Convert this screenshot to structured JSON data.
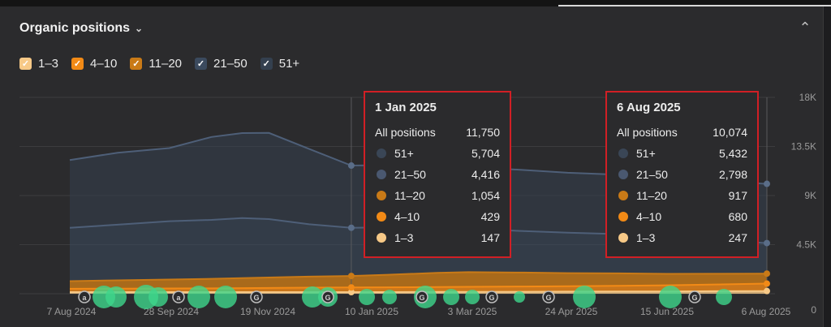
{
  "header": {
    "title": "Organic positions"
  },
  "legend": [
    {
      "label": "1–3",
      "color": "#f7c987",
      "checked": true
    },
    {
      "label": "4–10",
      "color": "#f28a16",
      "checked": true
    },
    {
      "label": "11–20",
      "color": "#c97a17",
      "checked": true
    },
    {
      "label": "21–50",
      "color": "#3b4a5e",
      "checked": true
    },
    {
      "label": "51+",
      "color": "#34404f",
      "checked": true
    }
  ],
  "tooltips": [
    {
      "date": "1 Jan 2025",
      "all_label": "All positions",
      "all_value": "11,750",
      "rows": [
        {
          "label": "51+",
          "value": "5,704",
          "color": "#3a4656"
        },
        {
          "label": "21–50",
          "value": "4,416",
          "color": "#4a5870"
        },
        {
          "label": "11–20",
          "value": "1,054",
          "color": "#c97a17"
        },
        {
          "label": "4–10",
          "value": "429",
          "color": "#f28a16"
        },
        {
          "label": "1–3",
          "value": "147",
          "color": "#f7c987"
        }
      ]
    },
    {
      "date": "6 Aug 2025",
      "all_label": "All positions",
      "all_value": "10,074",
      "rows": [
        {
          "label": "51+",
          "value": "5,432",
          "color": "#3a4656"
        },
        {
          "label": "21–50",
          "value": "2,798",
          "color": "#4a5870"
        },
        {
          "label": "11–20",
          "value": "917",
          "color": "#c97a17"
        },
        {
          "label": "4–10",
          "value": "680",
          "color": "#f28a16"
        },
        {
          "label": "1–3",
          "value": "247",
          "color": "#f7c987"
        }
      ]
    }
  ],
  "chart_data": {
    "type": "area",
    "stacked": true,
    "x_labels": [
      "7 Aug 2024",
      "28 Sep 2024",
      "19 Nov 2024",
      "10 Jan 2025",
      "3 Mar 2025",
      "24 Apr 2025",
      "15 Jun 2025",
      "6 Aug 2025"
    ],
    "y_ticks": [
      "0",
      "4.5K",
      "9K",
      "13.5K",
      "18K"
    ],
    "ylim": [
      0,
      18000
    ],
    "x_dates": [
      "2024-08-07",
      "2024-09-01",
      "2024-09-28",
      "2024-10-20",
      "2024-11-05",
      "2024-11-19",
      "2024-12-10",
      "2025-01-01",
      "2025-01-20",
      "2025-02-15",
      "2025-03-03",
      "2025-04-01",
      "2025-04-24",
      "2025-05-20",
      "2025-06-15",
      "2025-07-10",
      "2025-08-06"
    ],
    "series": [
      {
        "name": "1–3",
        "color": "#f7c987",
        "values": [
          150,
          150,
          150,
          150,
          150,
          150,
          150,
          147,
          150,
          160,
          170,
          180,
          190,
          200,
          210,
          230,
          247
        ]
      },
      {
        "name": "4–10",
        "color": "#f28a16",
        "values": [
          300,
          320,
          330,
          340,
          360,
          380,
          410,
          429,
          440,
          450,
          460,
          480,
          500,
          520,
          560,
          620,
          680
        ]
      },
      {
        "name": "11–20",
        "color": "#c97a17",
        "values": [
          700,
          760,
          820,
          880,
          920,
          960,
          1010,
          1054,
          1150,
          1300,
          1350,
          1280,
          1200,
          1150,
          1050,
          980,
          917
        ]
      },
      {
        "name": "21–50",
        "color": "#3b4a5e",
        "values": [
          4900,
          5100,
          5350,
          5400,
          5500,
          5350,
          4800,
          4416,
          4350,
          4200,
          4000,
          3800,
          3700,
          3600,
          3400,
          3100,
          2798
        ]
      },
      {
        "name": "51+",
        "color": "#34404f",
        "values": [
          6200,
          6600,
          6700,
          7600,
          7800,
          7900,
          6900,
          5704,
          5700,
          5680,
          5650,
          5600,
          5500,
          5450,
          5440,
          5435,
          5432
        ]
      }
    ],
    "annotations": [
      "a",
      "a",
      "G",
      "G",
      "G",
      "G",
      "G",
      "G"
    ]
  }
}
